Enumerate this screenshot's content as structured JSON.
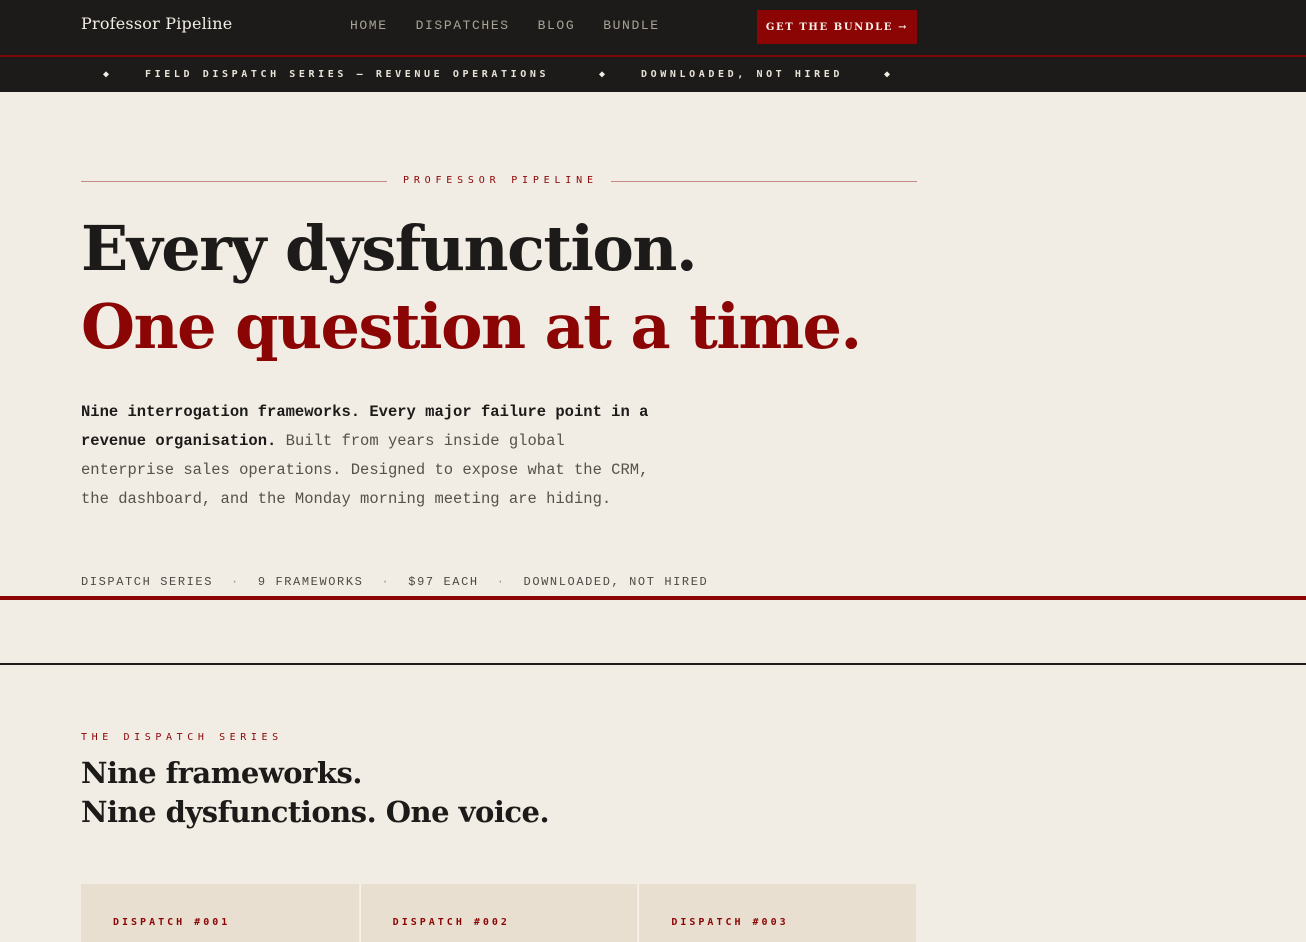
{
  "nav": {
    "brand": "Professor Pipeline",
    "links": [
      "HOME",
      "DISPATCHES",
      "BLOG",
      "BUNDLE"
    ],
    "cta": "GET THE BUNDLE →"
  },
  "ticker": {
    "items": [
      "FIELD DISPATCH SERIES — REVENUE OPERATIONS",
      "DOWNLOADED, NOT HIRED"
    ]
  },
  "hero": {
    "eyebrow": "PROFESSOR PIPELINE",
    "headline_1": "Every dysfunction.",
    "headline_2": "One question at a time.",
    "lede_bold": "Nine interrogation frameworks. Every major failure point in a revenue organisation.",
    "lede_rest": " Built from years inside global enterprise sales operations. Designed to expose what the CRM, the dashboard, and the Monday morning meeting are hiding.",
    "meta": [
      "DISPATCH SERIES",
      "9 FRAMEWORKS",
      "$97 EACH",
      "DOWNLOADED, NOT HIRED"
    ],
    "meta_separator": "·"
  },
  "series": {
    "eyebrow": "THE DISPATCH SERIES",
    "title_1": "Nine frameworks.",
    "title_2": "Nine dysfunctions. One voice.",
    "cards": [
      "DISPATCH #001",
      "DISPATCH #002",
      "DISPATCH #003"
    ]
  },
  "colors": {
    "accent": "#8b0505",
    "dark": "#1c1b19",
    "paper": "#f2ede4",
    "card": "#e8dfd0"
  }
}
